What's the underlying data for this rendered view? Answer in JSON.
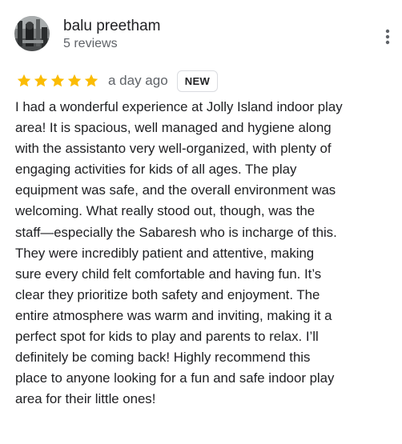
{
  "review": {
    "author_name": "balu preetham",
    "author_meta": "5 reviews",
    "rating": 5,
    "rating_max": 5,
    "star_color": "#fbbc04",
    "date": "a day ago",
    "badge": "NEW",
    "text_lines": [
      "I had a wonderful experience at Jolly Island indoor play",
      "area! It is spacious, well managed and hygiene along",
      "with the assistanto very well-organized, with plenty of",
      "engaging activities for kids of all ages. The play",
      "equipment was safe, and the overall environment was",
      "welcoming. What really stood out, though, was the",
      "staff—especially the Sabaresh who is incharge of this.",
      "They were incredibly patient and attentive, making",
      "sure every child felt comfortable and having fun. It’s",
      "clear they prioritize both safety and enjoyment. The",
      "entire atmosphere was warm and inviting, making it a",
      "perfect spot for kids to play and parents to relax. I’ll",
      "definitely be coming back! Highly recommend this",
      "place to anyone looking for a fun and safe indoor play",
      "area for their little ones!"
    ]
  },
  "icons": {
    "avatar": "profile-photo",
    "more": "more-vert-icon",
    "star": "star-icon"
  }
}
